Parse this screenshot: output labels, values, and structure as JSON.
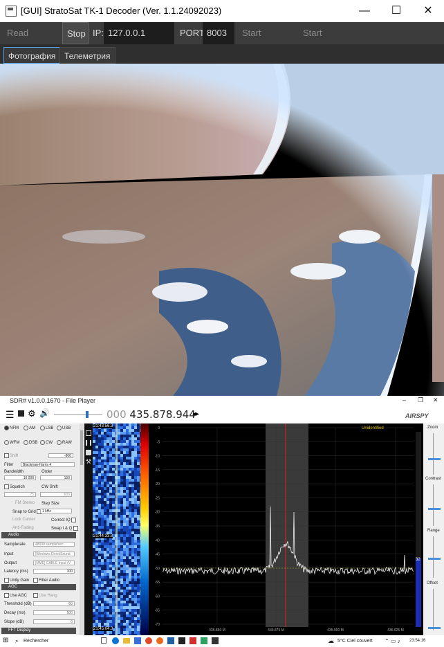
{
  "decoder": {
    "title": "[GUI] StratoSat TK-1 Decoder (Ver. 1.1.24092023)",
    "buttons": {
      "read_stream": "Read Stream",
      "stop": "Stop",
      "ip_label": "IP:",
      "ip_value": "127.0.0.1",
      "port_label": "PORT:",
      "port_value": "8003",
      "start_decoder": "Start Decoder",
      "start_soundmodem": "Start Soundmodem"
    },
    "tabs": [
      "Фотография",
      "Телеметрия"
    ],
    "window_controls": {
      "minimize": "—",
      "maximize": "☐",
      "close": "✕"
    }
  },
  "sdr": {
    "title": "SDR# v1.0.0.1670 - File Player",
    "frequency_dim": "000",
    "frequency": "435.878.944",
    "logo": "AIRSPY",
    "modes": [
      "NFM",
      "AM",
      "LSB",
      "USB",
      "WFM",
      "DSB",
      "CW",
      "RAW"
    ],
    "shift_label": "Shift",
    "shift_value": "-800",
    "filter_label": "Filter",
    "filter_value": "Blackman-Harris 4",
    "bandwidth_label": "Bandwidth",
    "bandwidth_value": "10 000",
    "order_label": "Order",
    "order_value": "150",
    "squelch_label": "Squelch",
    "cw_shift_label": "CW Shift",
    "squelch_value": "75",
    "cw_shift_value": "600",
    "fm_stereo_label": "FM Stereo",
    "step_size_label": "Step Size",
    "snap_label": "Snap to Grid",
    "step_value": "1 kHz",
    "lock_carrier_label": "Lock Carrier",
    "correct_iq_label": "Correct IQ",
    "anti_fading_label": "Anti-Fading",
    "swap_iq_label": "Swap I & Q",
    "audio_header": "Audio",
    "samplerate_label": "Samplerate",
    "samplerate_value": "48000 sample/sec",
    "input_label": "Input",
    "input_value": "[Windows DirectSound",
    "output_label": "Output",
    "output_value": "[MME] CABLE Input (V",
    "latency_label": "Latency (ms)",
    "latency_value": "100",
    "unity_gain_label": "Unity Gain",
    "filter_audio_label": "Filter Audio",
    "agc_header": "AGC",
    "use_agc_label": "Use AGC",
    "use_hang_label": "Use Hang",
    "threshold_label": "Threshold (dB)",
    "threshold_value": "-50",
    "decay_label": "Decay (ms)",
    "decay_value": "500",
    "slope_label": "Slope (dB)",
    "slope_value": "0",
    "fft_header": "FFT Display",
    "waterfall_times": [
      "21:43:56.3",
      "21:44:33.8",
      "21:45:04.3"
    ],
    "unidentified": "Unidentified",
    "y_ticks": [
      "0",
      "-5",
      "-10",
      "-15",
      "-20",
      "-25",
      "-30",
      "-35",
      "-40",
      "-45",
      "-50",
      "-55",
      "-60",
      "-65",
      "-70"
    ],
    "x_ticks": [
      "435.850 M",
      "435.875 M",
      "435.900 M",
      "435.925 M"
    ],
    "right_labels": [
      "Zoom",
      "Contrast",
      "Range",
      "Offset"
    ],
    "range_value": "32"
  },
  "taskbar": {
    "search": "Rechercher",
    "weather": "5°C  Ciel couvert",
    "time": "23:54:16"
  }
}
